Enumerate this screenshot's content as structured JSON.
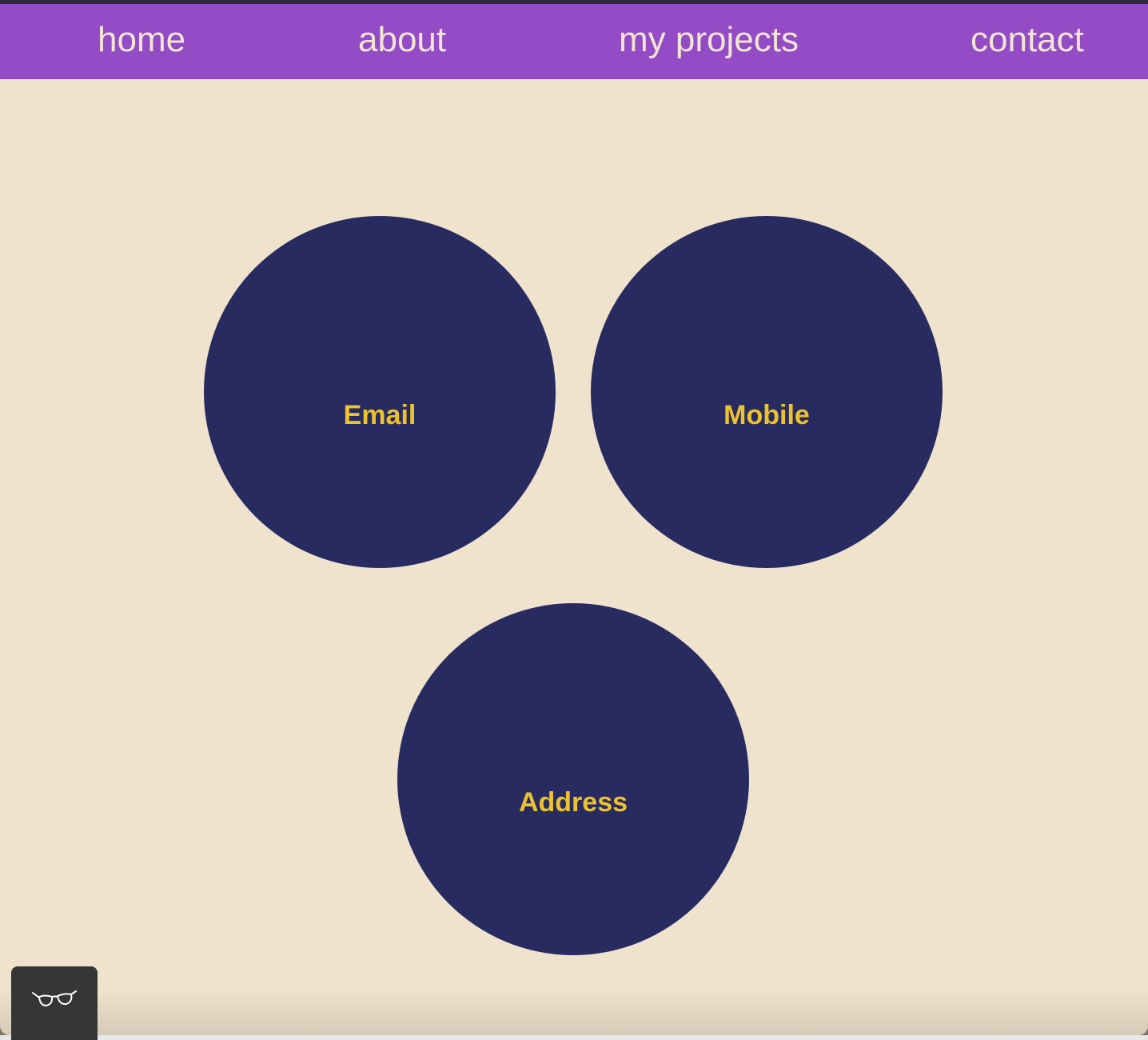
{
  "nav": {
    "items": [
      {
        "label": "home"
      },
      {
        "label": "about"
      },
      {
        "label": "my projects"
      },
      {
        "label": "contact"
      }
    ]
  },
  "contact": {
    "cards": [
      {
        "label": "Email"
      },
      {
        "label": "Mobile"
      },
      {
        "label": "Address"
      }
    ]
  },
  "reader": {
    "icon": "glasses-icon"
  },
  "colors": {
    "nav_background": "#934cc6",
    "nav_text": "#f3e5d3",
    "page_background": "#f0e3cd",
    "circle_fill": "#272b60",
    "circle_text": "#edc22f",
    "reader_button": "#363636"
  }
}
